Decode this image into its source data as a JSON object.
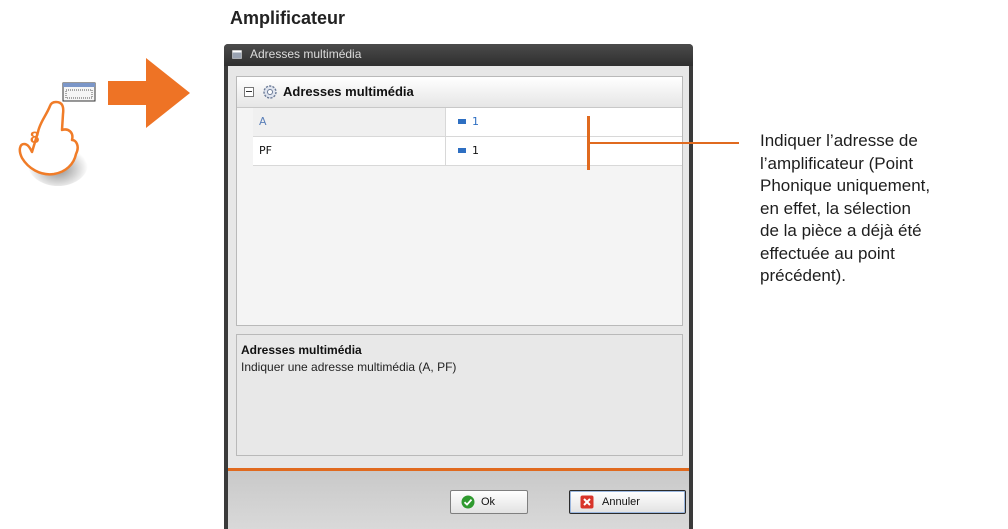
{
  "heading": "Amplificateur",
  "step": {
    "number": "8",
    "arrow_color": "#ee7325"
  },
  "window": {
    "title": "Adresses multimédia",
    "category": "Adresses multimédia",
    "properties": [
      {
        "name": "A",
        "value": "1"
      },
      {
        "name": "PF",
        "value": "1"
      }
    ],
    "description": {
      "title": "Adresses multimédia",
      "text": "Indiquer une adresse multimédia (A, PF)"
    },
    "buttons": {
      "ok": "Ok",
      "cancel": "Annuler"
    }
  },
  "callout": {
    "lines": [
      "Indiquer l’adresse de",
      "l’amplificateur (Point",
      "Phonique uniquement,",
      "en effet, la sélection",
      "de la pièce a déjà été",
      "effectuée au point",
      "précédent)."
    ]
  },
  "colors": {
    "accent": "#e06a1f",
    "value_link": "#2e6fc2"
  }
}
